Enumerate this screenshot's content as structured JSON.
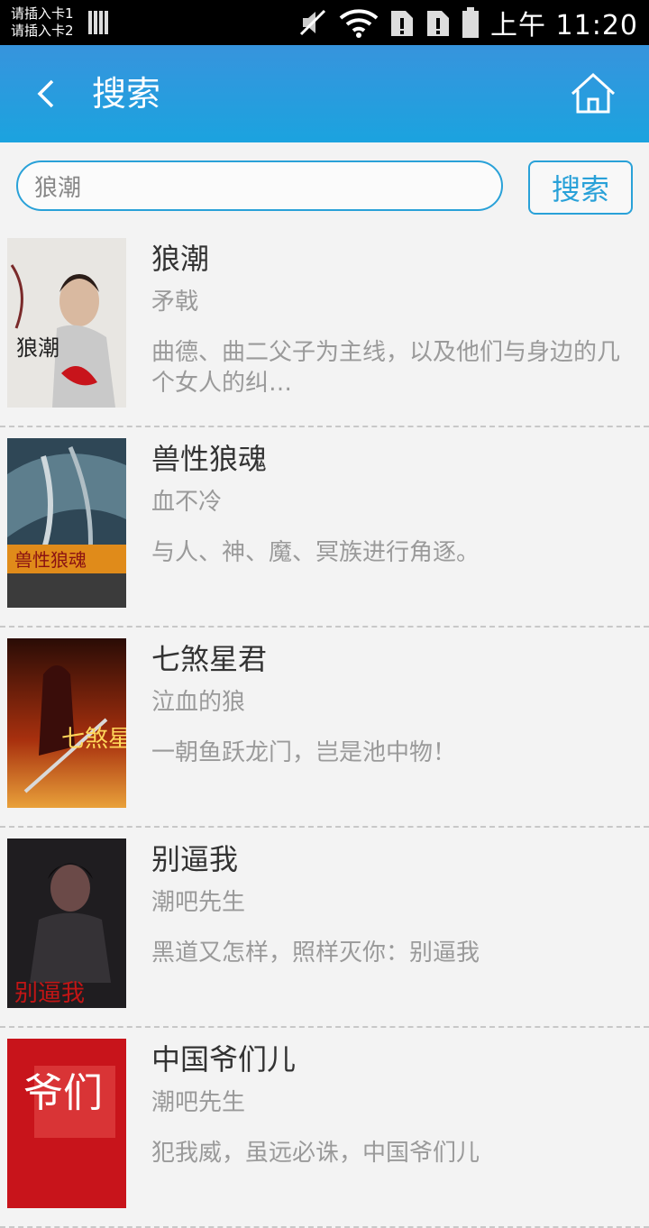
{
  "status_bar": {
    "sim1": "请插入卡1",
    "sim2": "请插入卡2",
    "time": "上午 11:20",
    "icons": [
      "signal-bars-icon",
      "mute-icon",
      "wifi-icon",
      "sim-alert-icon",
      "sim-alert-icon",
      "battery-icon"
    ]
  },
  "app_bar": {
    "title": "搜索",
    "back_icon": "back-chevron-icon",
    "home_icon": "home-icon",
    "color": "#1ba3df"
  },
  "search": {
    "query": "狼潮",
    "placeholder": "",
    "button_label": "搜索"
  },
  "results": [
    {
      "title": "狼潮",
      "author": "矛戟",
      "summary": "曲德、曲二父子为主线，以及他们与身边的几个女人的纠…",
      "cover_text": "狼潮"
    },
    {
      "title": "兽性狼魂",
      "author": "血不冷",
      "summary": "与人、神、魔、冥族进行角逐。",
      "cover_text": "兽性狼魂"
    },
    {
      "title": "七煞星君",
      "author": "泣血的狼",
      "summary": "一朝鱼跃龙门，岂是池中物！",
      "cover_text": "七煞星君"
    },
    {
      "title": "别逼我",
      "author": "潮吧先生",
      "summary": "黑道又怎样，照样灭你：别逼我",
      "cover_text": "别逼我"
    },
    {
      "title": "中国爷们儿",
      "author": "潮吧先生",
      "summary": "犯我威，虽远必诛，中国爷们儿",
      "cover_text": "爷们"
    }
  ]
}
